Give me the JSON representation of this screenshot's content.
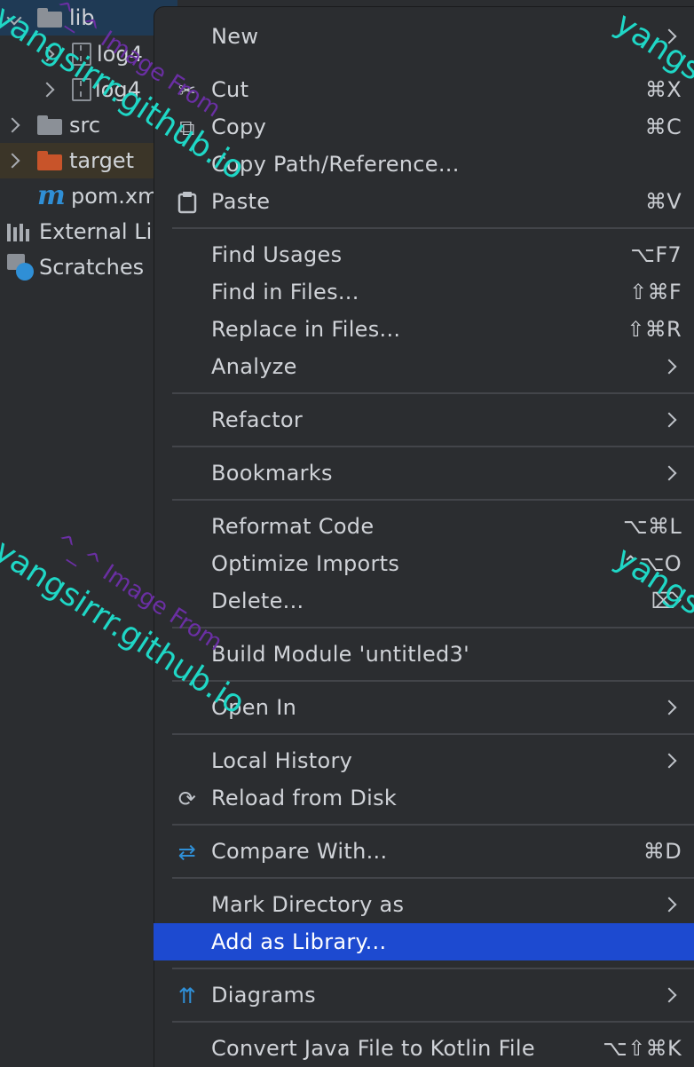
{
  "tree": {
    "rows": [
      {
        "label": "lib",
        "icon": "folder-icon",
        "color": "#8b9097"
      },
      {
        "label": "log4",
        "icon": "jar-icon"
      },
      {
        "label": "log4",
        "icon": "jar-icon"
      },
      {
        "label": "src",
        "icon": "folder-icon",
        "color": "#8b9097"
      },
      {
        "label": "target",
        "icon": "folder-icon",
        "color": "#c8542a"
      },
      {
        "label": "pom.xm",
        "icon": "maven-icon",
        "glyph": "m"
      },
      {
        "label": "External Li",
        "icon": "external-libraries-icon"
      },
      {
        "label": "Scratches",
        "icon": "scratches-icon"
      }
    ]
  },
  "menu": {
    "highlight_color": "#1d4ad0",
    "items": [
      {
        "label": "New",
        "shortcut": "",
        "submenu": true
      },
      {
        "label": "Cut",
        "shortcut": "⌘X",
        "icon": "scissors-icon",
        "glyph": "✂"
      },
      {
        "label": "Copy",
        "shortcut": "⌘C",
        "icon": "copy-icon",
        "glyph": "⧉"
      },
      {
        "label": "Copy Path/Reference...",
        "shortcut": ""
      },
      {
        "label": "Paste",
        "shortcut": "⌘V",
        "icon": "clipboard-icon",
        "glyph": "📋"
      },
      {
        "label": "Find Usages",
        "shortcut": "⌥F7"
      },
      {
        "label": "Find in Files...",
        "shortcut": "⇧⌘F"
      },
      {
        "label": "Replace in Files...",
        "shortcut": "⇧⌘R"
      },
      {
        "label": "Analyze",
        "shortcut": "",
        "submenu": true
      },
      {
        "label": "Refactor",
        "shortcut": "",
        "submenu": true
      },
      {
        "label": "Bookmarks",
        "shortcut": "",
        "submenu": true
      },
      {
        "label": "Reformat Code",
        "shortcut": "⌥⌘L"
      },
      {
        "label": "Optimize Imports",
        "shortcut": "⌃⌥O"
      },
      {
        "label": "Delete...",
        "shortcut": "⌦"
      },
      {
        "label": "Build Module 'untitled3'",
        "shortcut": ""
      },
      {
        "label": "Open In",
        "shortcut": "",
        "submenu": true
      },
      {
        "label": "Local History",
        "shortcut": "",
        "submenu": true
      },
      {
        "label": "Reload from Disk",
        "shortcut": "",
        "icon": "reload-icon",
        "glyph": "⟳"
      },
      {
        "label": "Compare With...",
        "shortcut": "⌘D",
        "icon": "compare-icon",
        "glyph": "⇄"
      },
      {
        "label": "Mark Directory as",
        "shortcut": "",
        "submenu": true
      },
      {
        "label": "Add as Library...",
        "shortcut": "",
        "highlighted": true
      },
      {
        "label": "Diagrams",
        "shortcut": "",
        "submenu": true,
        "icon": "diagrams-icon",
        "glyph": "⇈"
      },
      {
        "label": "Convert Java File to Kotlin File",
        "shortcut": "⌥⇧⌘K"
      }
    ]
  },
  "watermark": {
    "text": "yangsirrr.github.io",
    "subtext": "^_^ Image From"
  }
}
